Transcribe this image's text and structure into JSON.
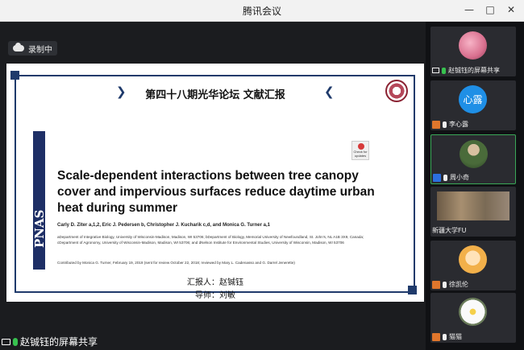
{
  "window": {
    "title": "腾讯会议",
    "controls": [
      "—",
      "□",
      "✕"
    ]
  },
  "main": {
    "recording_label": "录制中",
    "share_label": "赵铖钰的屏幕共享"
  },
  "slide": {
    "title": "第四十八期光华论坛  文献汇报",
    "left_arrow": "❯",
    "right_arrow": "❮",
    "journal": "PNAS",
    "badge_text": "Check for updates",
    "paper_title": "Scale-dependent interactions between tree canopy cover and impervious surfaces reduce daytime urban heat during summer",
    "authors": "Carly D. Ziter a,1,2, Eric J. Pedersen b, Christopher J. Kucharik c,d, and Monica G. Turner a,1",
    "affiliations": "aDepartment of Integrative Biology, University of Wisconsin-Madison, Madison, WI 53706; bDepartment of Biology, Memorial University of Newfoundland, St. John's, NL A1B 3X9, Canada; cDepartment of Agronomy, University of Wisconsin-Madison, Madison, WI 53706; and dNelson Institute for Environmental Studies, University of Wisconsin, Madison, WI 53706",
    "contributed": "Contributed by Monica G. Turner, February 19, 2019 (sent for review October 22, 2018; reviewed by Mary L. Cadenasso and G. Darrel Jenerette)",
    "reporter": "汇报人：赵铖钰",
    "advisor": "导师：刘敏"
  },
  "participants": [
    {
      "name": "赵铖钰的屏幕共享",
      "avatar": "flower-pink"
    },
    {
      "name": "李心露",
      "avatar_text": "心露"
    },
    {
      "name": "周小奇",
      "avatar": "portrait"
    },
    {
      "name": "新疆大学FU",
      "avatar": "group-photo"
    },
    {
      "name": "徐凯伦",
      "avatar": "anime"
    },
    {
      "name": "猫猫",
      "avatar": "flower-white"
    }
  ],
  "colors": {
    "accent_green": "#37c24f",
    "slide_navy": "#1f3a6b",
    "avatar_blue": "#1f8fe6"
  }
}
